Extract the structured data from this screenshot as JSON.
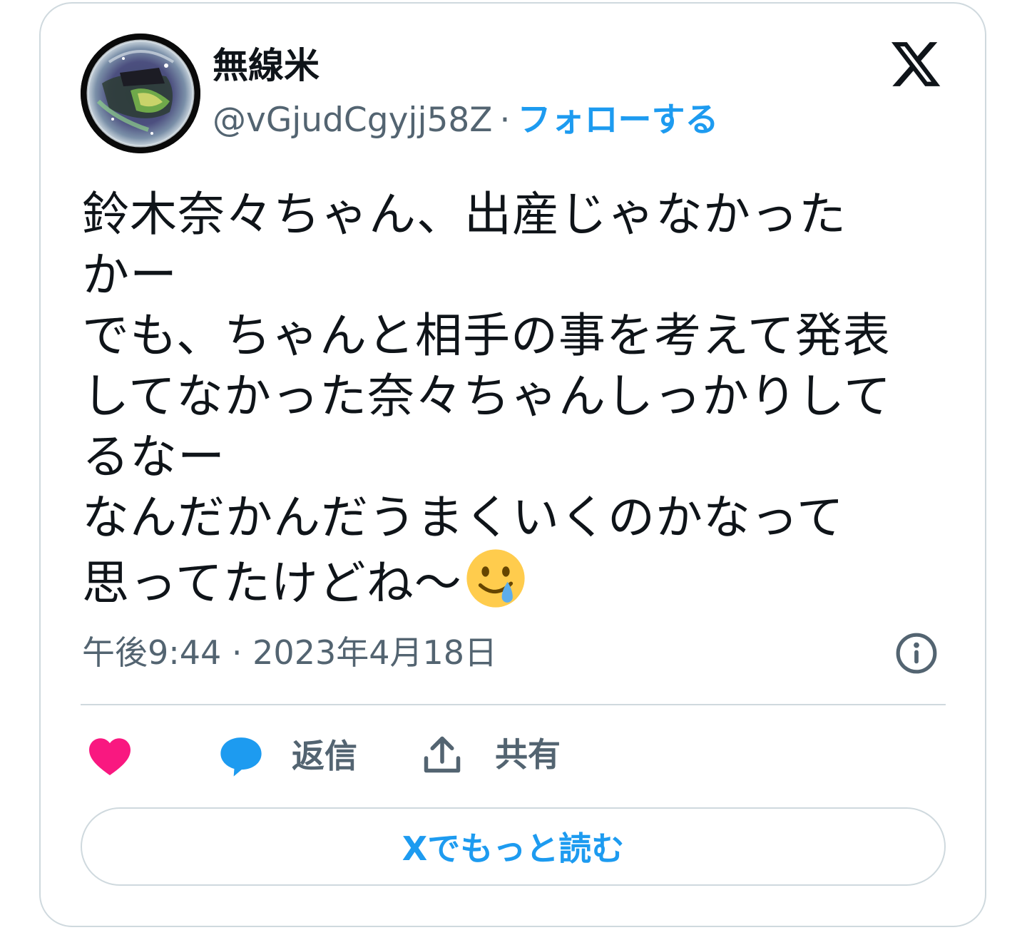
{
  "author": {
    "display_name": "無線米",
    "handle": "@vGjudCgyjj58Z",
    "separator": "·",
    "follow_label": "フォローする",
    "avatar_icon": "avatar-image"
  },
  "brand": {
    "logo_icon": "x-logo-icon"
  },
  "tweet": {
    "lines": [
      "鈴木奈々ちゃん、出産じゃなかった",
      "かー",
      "でも、ちゃんと相手の事を考えて発表",
      "してなかった奈々ちゃんしっかりして",
      "るなー",
      "なんだかんだうまくいくのかなって",
      "思ってたけどね〜"
    ],
    "emoji": "face-holding-back-tears-icon"
  },
  "meta": {
    "timestamp": "午後9:44 · 2023年4月18日",
    "info_icon": "info-icon"
  },
  "actions": {
    "like_icon": "heart-icon",
    "reply_icon": "speech-bubble-icon",
    "reply_label": "返信",
    "share_icon": "share-upload-icon",
    "share_label": "共有"
  },
  "read_more": {
    "label": "Xでもっと読む"
  },
  "colors": {
    "accent": "#1d9bf0",
    "heart": "#f91880",
    "muted_text": "#536471",
    "border": "#cfd9de"
  }
}
